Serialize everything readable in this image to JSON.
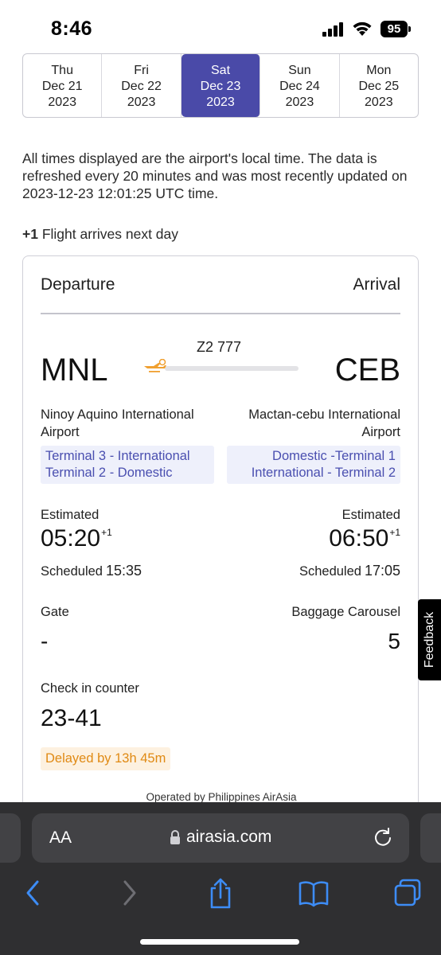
{
  "status_bar": {
    "time": "8:46",
    "battery": "95"
  },
  "date_tabs": [
    {
      "day": "Thu",
      "date": "Dec 21",
      "year": "2023",
      "active": false
    },
    {
      "day": "Fri",
      "date": "Dec 22",
      "year": "2023",
      "active": false
    },
    {
      "day": "Sat",
      "date": "Dec 23",
      "year": "2023",
      "active": true
    },
    {
      "day": "Sun",
      "date": "Dec 24",
      "year": "2023",
      "active": false
    },
    {
      "day": "Mon",
      "date": "Dec 25",
      "year": "2023",
      "active": false
    }
  ],
  "info_text": "All times displayed are the airport's local time. The data is refreshed every 20 minutes and was most recently updated on 2023-12-23 12:01:25 UTC time.",
  "next_day_note": {
    "marker": "+1",
    "text": "Flight arrives next day"
  },
  "flight": {
    "header_departure": "Departure",
    "header_arrival": "Arrival",
    "number": "Z2 777",
    "departure": {
      "code": "MNL",
      "airport": "Ninoy Aquino International Airport",
      "terminal_line1": "Terminal 3 - International",
      "terminal_line2": "Terminal 2 - Domestic",
      "estimated_label": "Estimated",
      "estimated_time": "05:20",
      "estimated_offset": "+1",
      "scheduled_label": "Scheduled",
      "scheduled_time": "15:35"
    },
    "arrival": {
      "code": "CEB",
      "airport": "Mactan-cebu International Airport",
      "terminal_line1": "Domestic -Terminal 1",
      "terminal_line2": "International - Terminal 2",
      "estimated_label": "Estimated",
      "estimated_time": "06:50",
      "estimated_offset": "+1",
      "scheduled_label": "Scheduled",
      "scheduled_time": "17:05"
    },
    "gate_label": "Gate",
    "gate_value": "-",
    "baggage_label": "Baggage Carousel",
    "baggage_value": "5",
    "checkin_label": "Check in counter",
    "checkin_value": "23-41",
    "delay_badge": "Delayed by 13h 45m",
    "operated_by": "Operated by Philippines AirAsia",
    "progress_fraction": 0
  },
  "feedback_label": "Feedback",
  "browser": {
    "text_size_label": "AA",
    "url": "airasia.com"
  },
  "colors": {
    "accent": "#4a4aa8",
    "terminal_text": "#4a4fb0",
    "delay_text": "#e08a14",
    "delay_bg": "#fdf1e0",
    "plane_icon": "#f0a030"
  }
}
